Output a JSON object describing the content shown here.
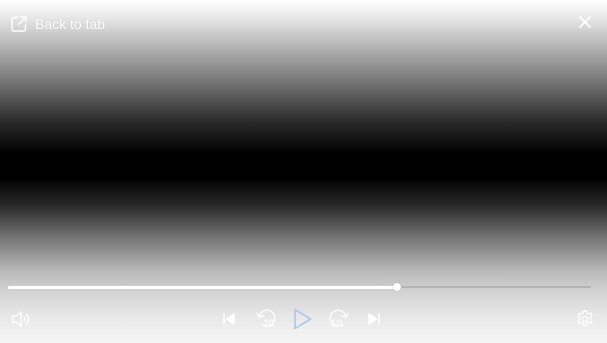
{
  "header": {
    "back_to_tab_label": "Back to tab",
    "back_icon": "external-link-icon",
    "close_icon": "close-icon"
  },
  "playback": {
    "progress_fraction": 0.667,
    "skip_back_seconds": "10",
    "skip_forward_seconds": "10"
  },
  "controls": {
    "volume_icon": "speaker-icon",
    "previous_icon": "skip-previous-icon",
    "rewind_icon": "rewind-10-icon",
    "play_icon": "play-icon",
    "forward_icon": "forward-10-icon",
    "next_icon": "skip-next-icon",
    "settings_icon": "gear-icon"
  },
  "colors": {
    "icon": "#ffffff",
    "play_icon": "#a8c4ea",
    "progress_played": "#ffffff",
    "progress_remaining": "#b4b4b4"
  }
}
